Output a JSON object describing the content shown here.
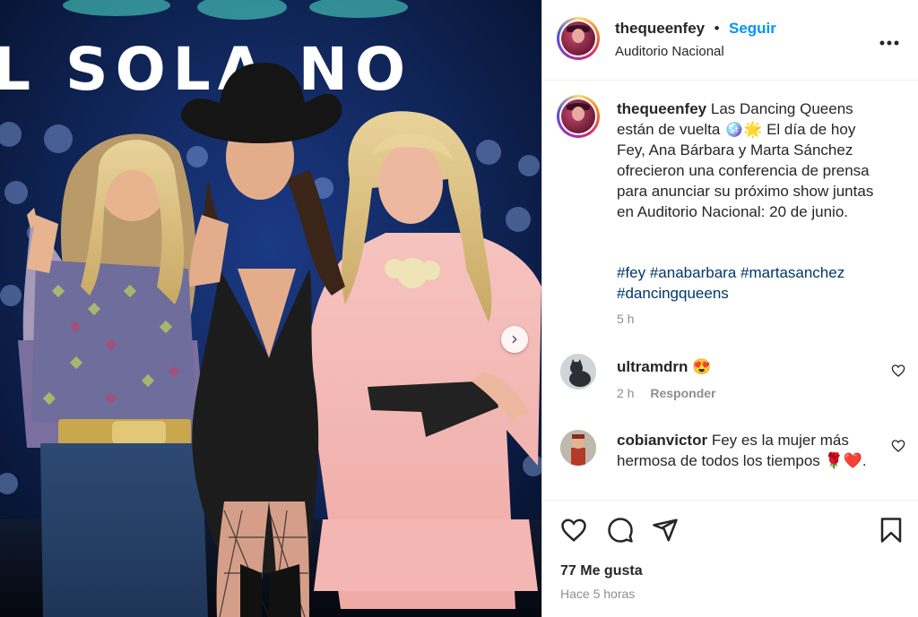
{
  "post": {
    "username": "thequeenfey",
    "follow_label": "Seguir",
    "separator": "•",
    "location": "Auditorio Nacional",
    "more_label": "•••"
  },
  "backdrop_text": "L SOLA NO",
  "caption": {
    "username": "thequeenfey",
    "text": "Las Dancing Queens están de vuelta 🪩🌟 El día de hoy Fey, Ana Bárbara y Marta Sánchez ofrecieron una conferencia de prensa para anunciar su próximo show juntas en Auditorio Nacional: 20 de junio.",
    "hashtags": "#fey #anabarbara #martasanchez #dancingqueens",
    "time": "5 h"
  },
  "comments": [
    {
      "username": "ultramdrn",
      "text": "😍",
      "time": "2 h",
      "reply_label": "Responder"
    },
    {
      "username": "cobianvictor",
      "text": "Fey es la mujer más hermosa de todos los tiempos 🌹❤️."
    }
  ],
  "likes": "77 Me gusta",
  "posted_time": "Hace 5 horas",
  "colors": {
    "link": "#0095f6",
    "hashtag": "#00376b",
    "muted": "#8e8e8e"
  }
}
